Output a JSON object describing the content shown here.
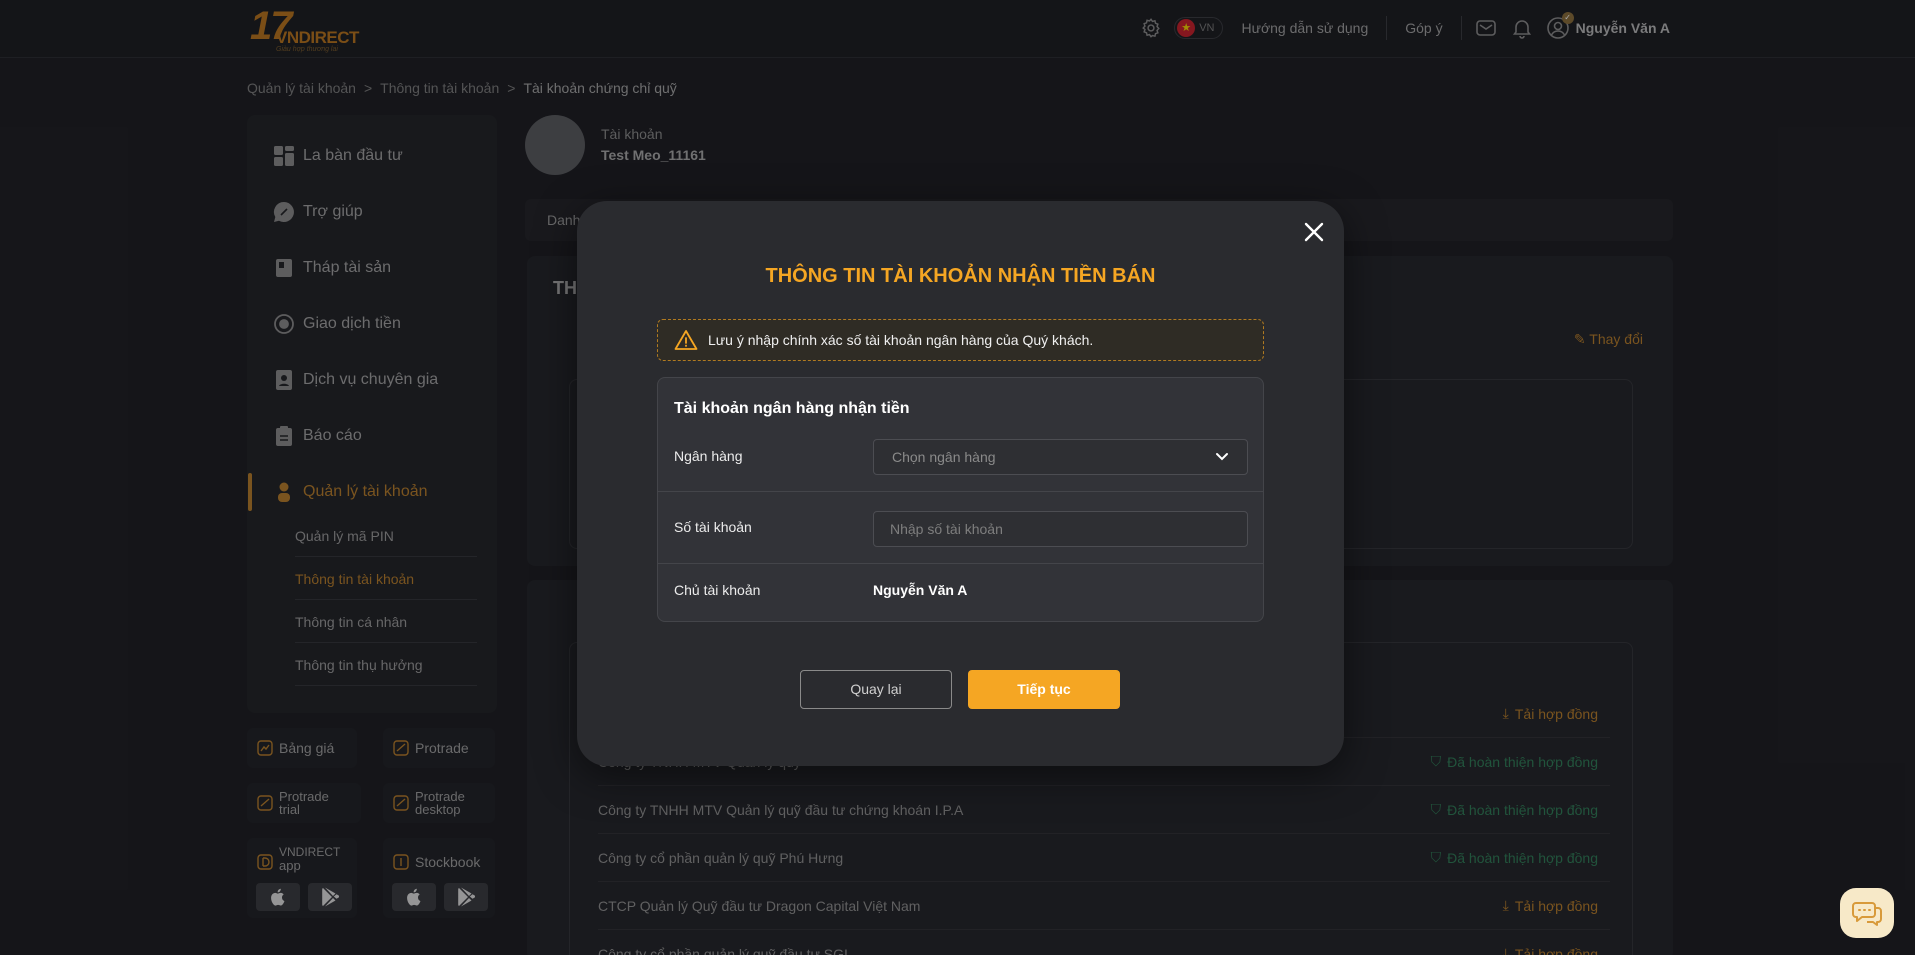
{
  "header": {
    "logo_number": "17",
    "logo_brand": "VNDIRECT",
    "logo_tagline": "Giàu hợp thương lai",
    "lang": "VN",
    "guide": "Hướng dẫn sử dụng",
    "feedback": "Góp ý",
    "user_name": "Nguyễn Văn A"
  },
  "breadcrumb": [
    "Quản lý tài khoản",
    ">",
    "Thông tin tài khoản",
    ">",
    "Tài khoản chứng chỉ quỹ"
  ],
  "sidebar": {
    "items": [
      {
        "label": "La bàn đầu tư"
      },
      {
        "label": "Trợ giúp"
      },
      {
        "label": "Tháp tài sản"
      },
      {
        "label": "Giao dịch tiền"
      },
      {
        "label": "Dịch vụ chuyên gia"
      },
      {
        "label": "Báo cáo"
      },
      {
        "label": "Quản lý tài khoản"
      }
    ],
    "sub_items": [
      {
        "label": "Quản lý mã PIN"
      },
      {
        "label": "Thông tin tài khoản"
      },
      {
        "label": "Thông tin cá nhân"
      },
      {
        "label": "Thông tin thụ hưởng"
      }
    ],
    "tiles": {
      "bang_gia": "Bảng giá",
      "protrade": "Protrade",
      "protrade_trial_1": "Protrade",
      "protrade_trial_2": "trial",
      "protrade_desktop_1": "Protrade",
      "protrade_desktop_2": "desktop",
      "vnd_app_1": "VNDIRECT",
      "vnd_app_2": "app",
      "stockbook": "Stockbook"
    }
  },
  "account": {
    "label": "Tài khoản",
    "name": "Test Meo_11161"
  },
  "background": {
    "tab_text": "Danh",
    "panel_title": "TH",
    "change": "Thay đổi",
    "rows": [
      {
        "name": "",
        "status": "Tải hợp đồng"
      },
      {
        "name": "Công ty TNHH MTV Quản lý quỹ",
        "status": "Đã hoàn thiện hợp đồng"
      },
      {
        "name": "Công ty TNHH MTV Quản lý quỹ đầu tư chứng khoán I.P.A",
        "status": "Đã hoàn thiện hợp đồng"
      },
      {
        "name": "Công ty cổ phần quản lý quỹ Phú Hưng",
        "status": "Đã hoàn thiện hợp đồng"
      },
      {
        "name": "CTCP Quản lý Quỹ đầu tư Dragon Capital Việt Nam",
        "status": "Tải hợp đồng"
      },
      {
        "name": "Công ty cổ phần quản lý quỹ đầu tư SGI",
        "status": "Tải hợp đồng"
      }
    ]
  },
  "modal": {
    "title": "THÔNG TIN TÀI KHOẢN NHẬN TIỀN BÁN",
    "notice": "Lưu ý nhập chính xác số tài khoản ngân hàng của Quý khách.",
    "form_title": "Tài khoản ngân hàng nhận tiền",
    "bank_label": "Ngân hàng",
    "bank_placeholder": "Chọn ngân hàng",
    "account_no_label": "Số tài khoản",
    "account_no_placeholder": "Nhập số tài khoản",
    "owner_label": "Chủ tài khoản",
    "owner_value": "Nguyễn Văn A",
    "back_button": "Quay lại",
    "next_button": "Tiếp tục"
  },
  "colors": {
    "accent": "#f5a623",
    "sidebar_active": "#b77d2a",
    "success": "#2f7d57"
  }
}
